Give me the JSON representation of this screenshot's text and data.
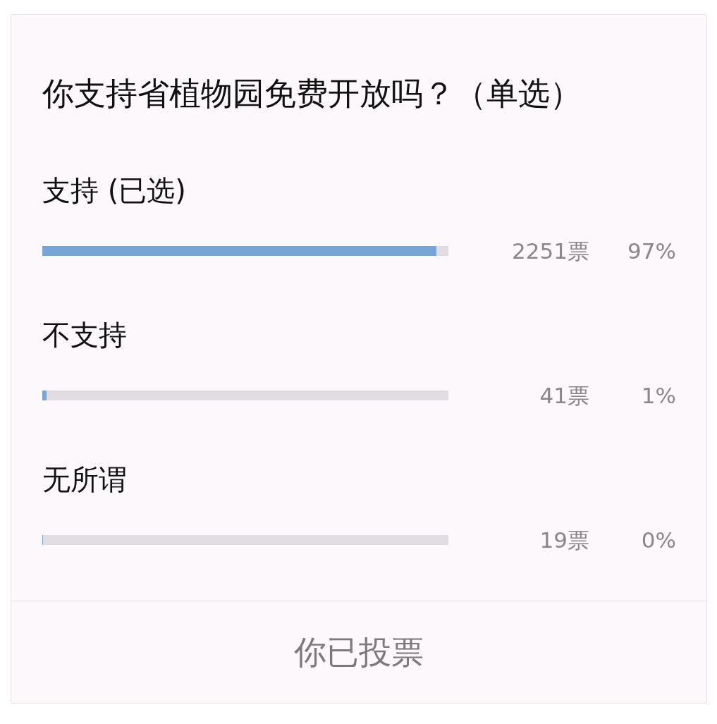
{
  "poll": {
    "question": "你支持省植物园免费开放吗？（单选）",
    "options": [
      {
        "label": "支持 (已选)",
        "level": 0.97,
        "votes": "2251票",
        "percent": "97%"
      },
      {
        "label": "不支持",
        "level": 0.01,
        "votes": "41票",
        "percent": "1%"
      },
      {
        "label": "无所谓",
        "level": 0,
        "votes": "19票",
        "percent": "0%"
      }
    ],
    "status_button": "你已投票"
  }
}
